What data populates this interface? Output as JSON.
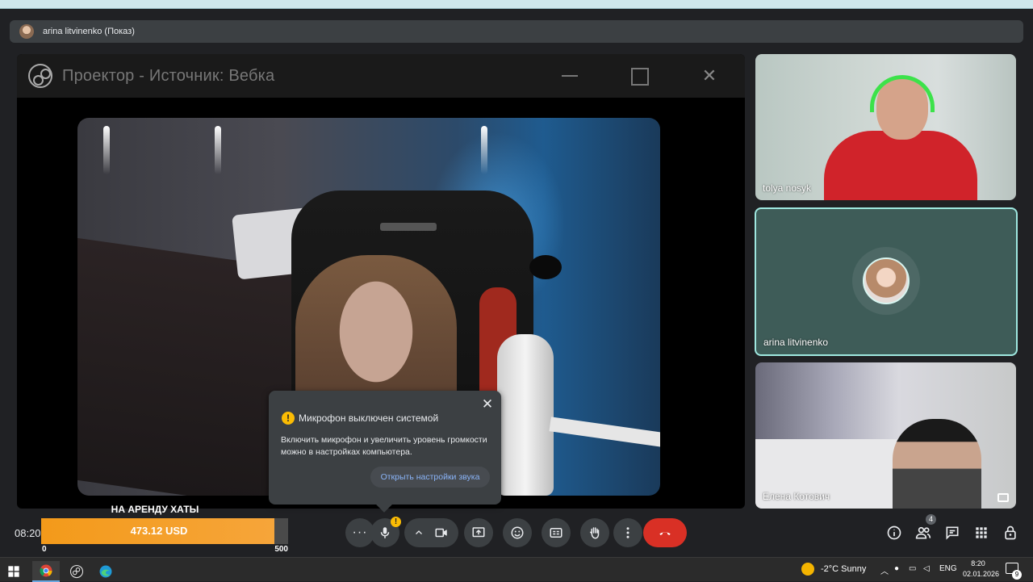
{
  "meet": {
    "presenting_label": "arina litvinenko (Показ)",
    "time": "08:20"
  },
  "projector": {
    "title": "Проектор - Источник: Вебка",
    "close_glyph": "✕"
  },
  "mic_popup": {
    "title": "Микрофон выключен системой",
    "body": "Включить микрофон и увеличить уровень громкости можно в настройках компьютера.",
    "button": "Открыть настройки звука",
    "close_glyph": "✕",
    "warn_glyph": "!"
  },
  "participants": [
    {
      "name": "tolya nosyk"
    },
    {
      "name": "arina litvinenko"
    },
    {
      "name": "Елена Котович"
    }
  ],
  "donation": {
    "title": "НА АРЕНДУ ХАТЫ",
    "value": "473.12 USD",
    "min": "0",
    "max": "500",
    "progress": 0.946,
    "fill_color": "#f39a1a"
  },
  "controls": {
    "more_glyph": "···",
    "mic_warn_glyph": "!",
    "people_count": "4",
    "end_call_color": "#d93025"
  },
  "taskbar": {
    "weather": "-2°C  Sunny",
    "lang": "ENG",
    "time": "8:20",
    "date": "02.01.2026",
    "notif_count": "9"
  },
  "colors": {
    "accent_active_tile": "#9fe8e0",
    "warning": "#fbbc04",
    "link": "#8ab4f8"
  }
}
